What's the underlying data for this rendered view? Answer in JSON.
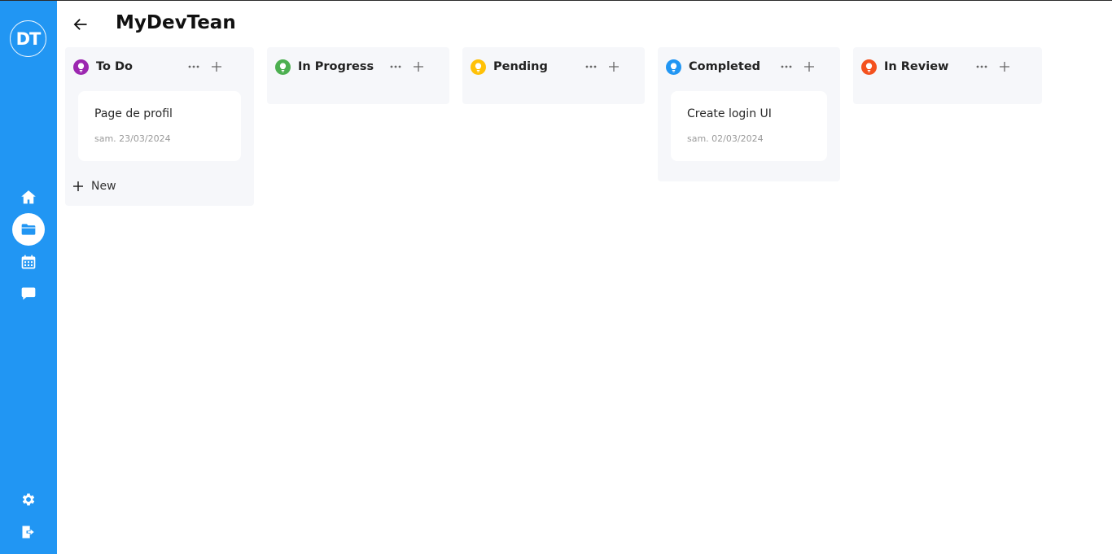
{
  "app": {
    "logo_text": "DT",
    "title": "MyDevTean"
  },
  "sidebar": {
    "items": [
      {
        "name": "home",
        "icon": "home-icon"
      },
      {
        "name": "projects",
        "icon": "folder-icon",
        "active": true
      },
      {
        "name": "calendar",
        "icon": "calendar-icon"
      },
      {
        "name": "messages",
        "icon": "chat-icon"
      }
    ],
    "bottom_items": [
      {
        "name": "settings",
        "icon": "gear-icon"
      },
      {
        "name": "logout",
        "icon": "logout-icon"
      }
    ]
  },
  "board": {
    "columns": [
      {
        "title": "To Do",
        "color": "#9c27b0",
        "cards": [
          {
            "title": "Page de profil",
            "date": "sam. 23/03/2024"
          }
        ],
        "new_label": "New"
      },
      {
        "title": "In Progress",
        "color": "#4caf50",
        "cards": []
      },
      {
        "title": "Pending",
        "color": "#ffc107",
        "cards": []
      },
      {
        "title": "Completed",
        "color": "#2196f3",
        "cards": [
          {
            "title": "Create login UI",
            "date": "sam. 02/03/2024"
          }
        ]
      },
      {
        "title": "In Review",
        "color": "#f4511e",
        "cards": []
      }
    ]
  },
  "colors": {
    "sidebar": "#2196f3",
    "column_bg": "#f6f7fa"
  }
}
